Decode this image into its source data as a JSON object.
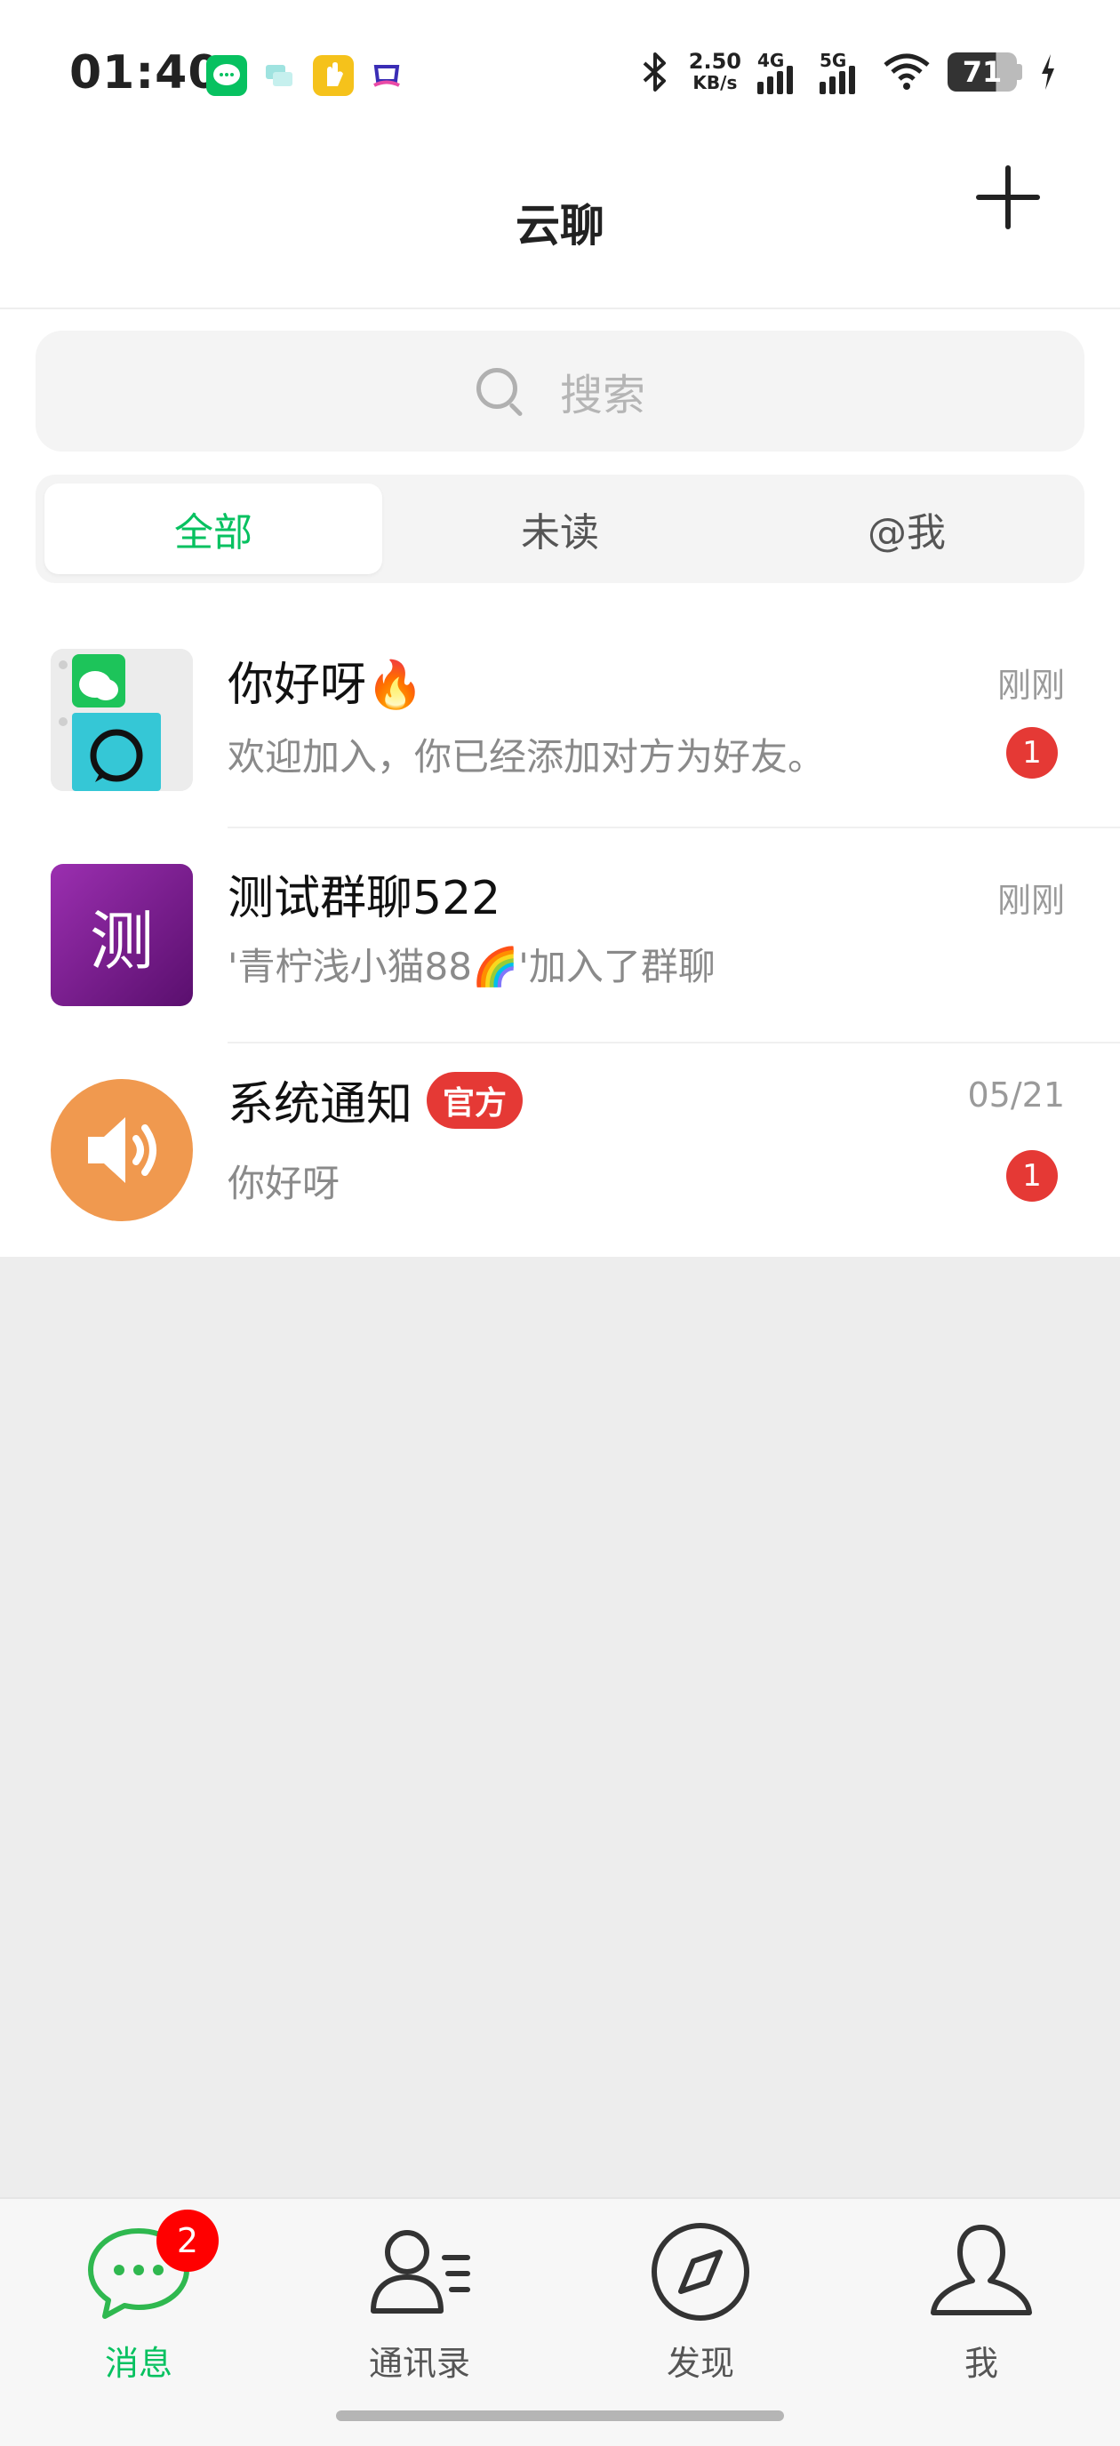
{
  "status_bar": {
    "time": "01:40",
    "net_speed": "2.50",
    "net_speed_unit": "KB/s",
    "sim1": "4G",
    "sim2": "5G",
    "battery": "71",
    "notification_icons": [
      "chat-app-icon",
      "message-app-icon",
      "hand-app-icon",
      "game-app-icon"
    ]
  },
  "header": {
    "title": "云聊",
    "add_icon": "plus-icon"
  },
  "search": {
    "placeholder": "搜索",
    "icon": "search-icon"
  },
  "tabs": [
    {
      "label": "全部",
      "active": true
    },
    {
      "label": "未读",
      "active": false
    },
    {
      "label": "@我",
      "active": false
    }
  ],
  "chats": [
    {
      "name": "你好呀🔥",
      "message": "欢迎加入，你已经添加对方为好友。",
      "time": "刚刚",
      "unread": "1"
    },
    {
      "name": "测试群聊522",
      "avatar_text": "测",
      "message": "'青柠浅小猫88🌈'加入了群聊",
      "time": "刚刚",
      "unread": ""
    },
    {
      "name": "系统通知",
      "badge": "官方",
      "message": "你好呀",
      "time": "05/21",
      "unread": "1"
    }
  ],
  "bottom_nav": [
    {
      "label": "消息",
      "icon": "chat-bubble-icon",
      "badge": "2",
      "active": true
    },
    {
      "label": "通讯录",
      "icon": "contacts-icon",
      "active": false
    },
    {
      "label": "发现",
      "icon": "compass-icon",
      "active": false
    },
    {
      "label": "我",
      "icon": "user-icon",
      "active": false
    }
  ],
  "colors": {
    "accent": "#07c160",
    "badge_red": "#e53935",
    "group_avatar": "#7b1f8c",
    "system_avatar": "#f0994f"
  }
}
